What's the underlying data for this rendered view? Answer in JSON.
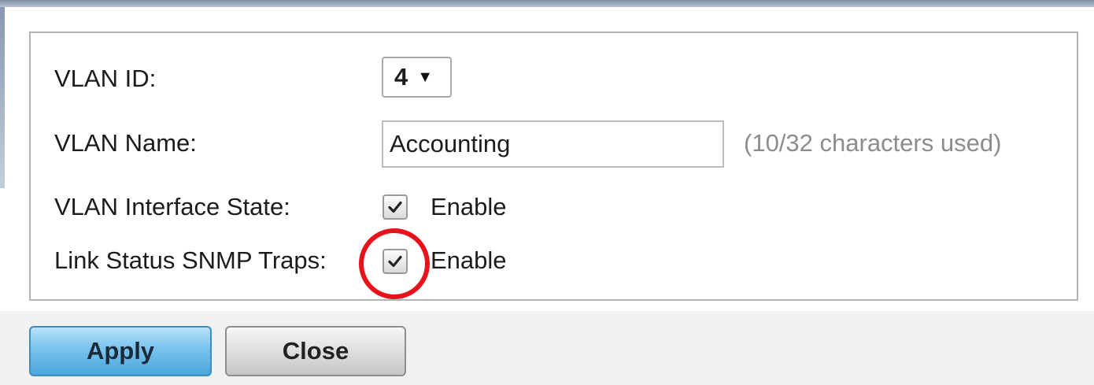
{
  "form": {
    "vlan_id": {
      "label": "VLAN ID:",
      "selected_value": "4"
    },
    "vlan_name": {
      "label": "VLAN Name:",
      "value": "Accounting",
      "char_hint": "(10/32 characters used)"
    },
    "interface_state": {
      "label": "VLAN Interface State:",
      "checked": true,
      "option_label": "Enable"
    },
    "snmp_traps": {
      "label": "Link Status SNMP Traps:",
      "checked": true,
      "option_label": "Enable"
    }
  },
  "buttons": {
    "apply_label": "Apply",
    "close_label": "Close"
  },
  "icons": {
    "dropdown": "chevron-down-icon",
    "checkmark": "checkmark-icon"
  },
  "colors": {
    "highlight": "#e8121c",
    "apply_accent": "#4aa7dd"
  }
}
